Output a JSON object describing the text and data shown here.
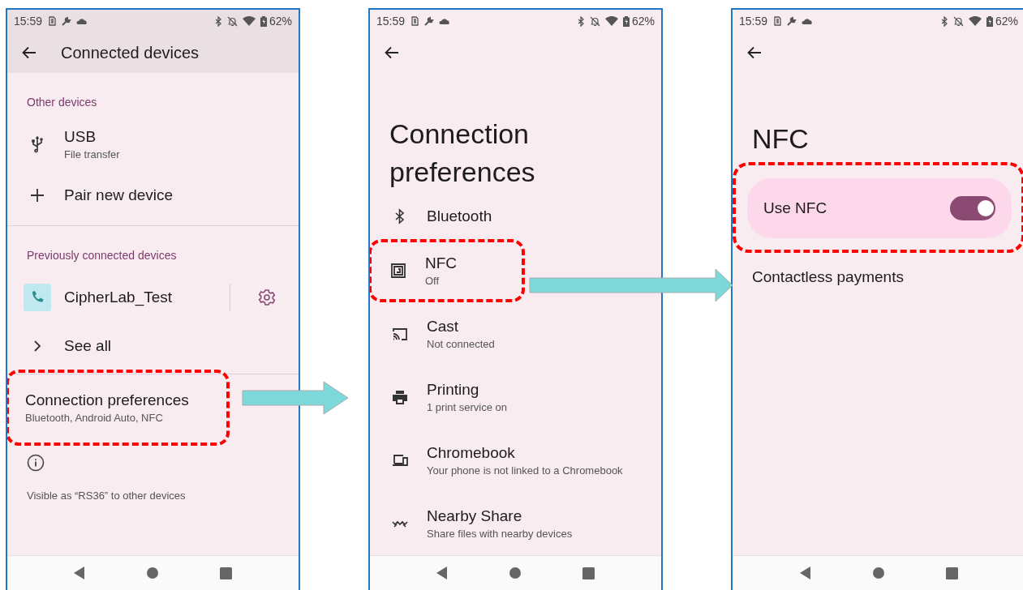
{
  "screens": [
    {
      "status_bar": {
        "time": "15:59",
        "battery": "62%"
      },
      "app_bar": {
        "title": "Connected devices"
      },
      "items": [
        {
          "kind": "header",
          "title": "Other devices"
        },
        {
          "kind": "usb",
          "title": "USB",
          "subtitle": "File transfer",
          "highlighted": false
        },
        {
          "kind": "add",
          "title": "Pair new device",
          "highlighted": false
        },
        {
          "kind": "divider"
        },
        {
          "kind": "header",
          "title": "Previously connected devices"
        },
        {
          "kind": "device",
          "title": "CipherLab_Test",
          "highlighted": false
        },
        {
          "kind": "see-all",
          "title": "See all",
          "highlighted": false
        },
        {
          "kind": "divider"
        },
        {
          "kind": "plain",
          "title": "Connection preferences",
          "subtitle": "Bluetooth, Android Auto, NFC",
          "highlighted": true
        },
        {
          "kind": "info",
          "title": "Visible as “RS36” to other devices"
        }
      ]
    },
    {
      "status_bar": {
        "time": "15:59",
        "battery": "62%"
      },
      "title": "Connection preferences",
      "items": [
        {
          "kind": "bluetooth",
          "title": "Bluetooth",
          "highlighted": false
        },
        {
          "kind": "nfc",
          "title": "NFC",
          "subtitle": "Off",
          "highlighted": true
        },
        {
          "kind": "cast",
          "title": "Cast",
          "subtitle": "Not connected",
          "highlighted": false
        },
        {
          "kind": "print",
          "title": "Printing",
          "subtitle": "1 print service on",
          "highlighted": false
        },
        {
          "kind": "chromebook",
          "title": "Chromebook",
          "subtitle": "Your phone is not linked to a Chromebook",
          "highlighted": false
        },
        {
          "kind": "nearby",
          "title": "Nearby Share",
          "subtitle": "Share files with nearby devices",
          "highlighted": false
        }
      ]
    },
    {
      "status_bar": {
        "time": "15:59",
        "battery": "62%"
      },
      "title": "NFC",
      "toggle": {
        "label": "Use NFC",
        "on": true,
        "highlighted": true
      },
      "items": [
        {
          "kind": "plain",
          "title": "Contactless payments",
          "highlighted": false
        }
      ]
    }
  ]
}
